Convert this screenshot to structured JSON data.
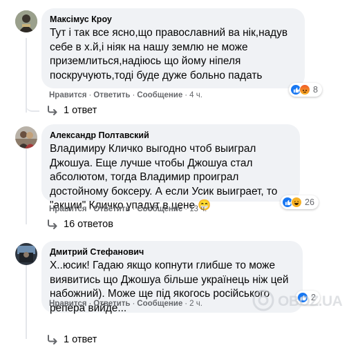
{
  "comments": [
    {
      "author": "Максімус Кроу",
      "text": "Тут і так все ясно,що православний ва нік,надув себе в х.й,і ніяк на нашу землю не може приземлиться,надіюсь що йому ніпеля поскручують,тоді буде дуже больно падать",
      "actions": {
        "like": "Нравится",
        "reply": "Ответить",
        "message": "Сообщение",
        "time": "4 ч."
      },
      "reactions": {
        "icons": [
          "like-reaction-icon",
          "angry-reaction-icon"
        ],
        "count": "8"
      },
      "replies": "1 ответ"
    },
    {
      "author": "Александр Полтавский",
      "text": "Владимиру Кличко выгодно чтоб выиграл Джошуа. Еще лучше чтобы Джошуа стал абсолютом, тогда Владимир проиграл достойному боксеру. А если Усик выиграет, то \"акции\" Кличко упадут в цене 😁",
      "actions": {
        "like": "Нравится",
        "reply": "Ответить",
        "message": "Сообщение",
        "time": "13 ч."
      },
      "reactions": {
        "icons": [
          "like-reaction-icon",
          "haha-reaction-icon"
        ],
        "count": "26"
      },
      "replies": "16 ответов"
    },
    {
      "author": "Дмитрий Стефанович",
      "text": "Х..юсик! Гадаю якщо копнути глибше то може виявитись що Джошуа більше українець ніж цей набожний). Може ще під якогось російського репера вийде...",
      "actions": {
        "like": "Нравится",
        "reply": "Ответить",
        "message": "Сообщение",
        "time": "2 ч."
      },
      "reactions": {
        "icons": [
          "like-reaction-icon"
        ],
        "count": "2"
      },
      "replies": "1 ответ"
    }
  ],
  "watermark": "OBOZ.UA",
  "colors": {
    "like": "#1877f2",
    "angry": "#f05a28",
    "haha": "#f7b125",
    "muted": "#65676b",
    "bubble": "#f0f2f5"
  }
}
